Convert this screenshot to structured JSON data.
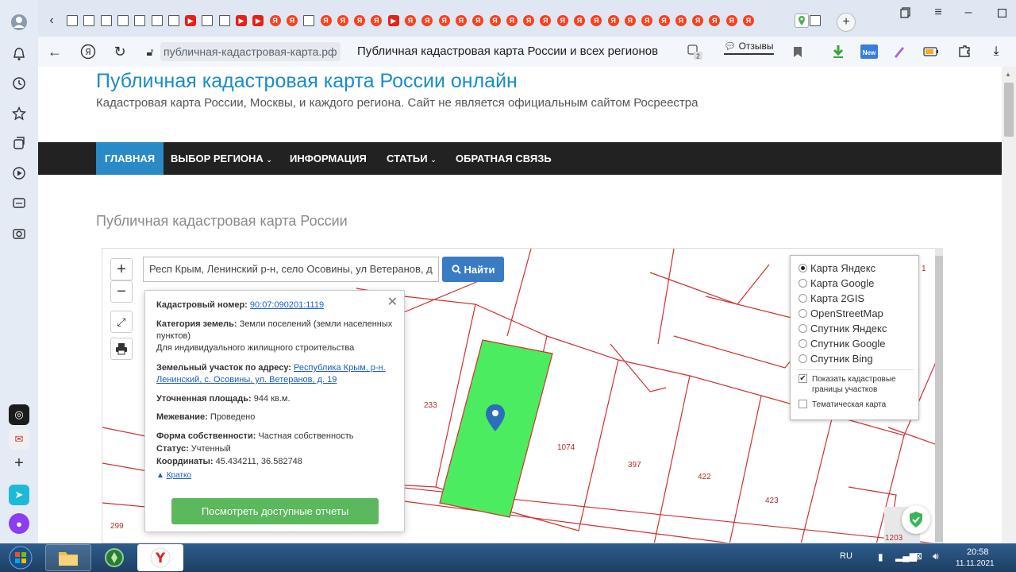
{
  "browser": {
    "url_domain": "публичная-кадастровая-карта.рф",
    "page_title": "Публичная кадастровая карта России и всех регионов",
    "reviews_label": "Отзывы",
    "badge_count": "2",
    "new_badge": "New"
  },
  "site": {
    "title": "Публичная кадастровая карта России онлайн",
    "description": "Кадастровая карта России, Москвы, и каждого региона. Сайт не является официальным сайтом Росреестра",
    "nav": [
      {
        "label": "ГЛАВНАЯ"
      },
      {
        "label": "ВЫБОР РЕГИОНА"
      },
      {
        "label": "ИНФОРМАЦИЯ"
      },
      {
        "label": "СТАТЬИ"
      },
      {
        "label": "ОБРАТНАЯ СВЯЗЬ"
      }
    ],
    "section_title": "Публичная кадастровая карта России"
  },
  "map": {
    "zoom_in": "+",
    "zoom_out": "−",
    "search_value": "Респ Крым, Ленинский р-н, село Осовины, ул Ветеранов, д",
    "find_button": "Найти",
    "popup": {
      "cad_label": "Кадастровый номер:",
      "cad_value": "90:07:090201:1119",
      "category_label": "Категория земель:",
      "category_value": "Земли поселений (земли населенных пунктов)",
      "category_use": "Для индивидуального жилищного строительства",
      "address_label": "Земельный участок по адресу:",
      "address_value": "Республика Крым, р-н. Ленинский, с. Осовины, ул. Ветеранов, д. 19",
      "area_label": "Уточненная площадь:",
      "area_value": "944 кв.м.",
      "survey_label": "Межевание:",
      "survey_value": "Проведено",
      "ownership_label": "Форма собственности:",
      "ownership_value": "Частная собственность",
      "status_label": "Статус:",
      "status_value": "Учтенный",
      "coords_label": "Координаты:",
      "coords_value": "45.434211, 36.582748",
      "collapse_link": "Кратко",
      "reports_button": "Посмотреть доступные отчеты"
    },
    "layers": [
      {
        "label": "Карта Яндекс",
        "selected": true
      },
      {
        "label": "Карта Google",
        "selected": false
      },
      {
        "label": "Карта 2GIS",
        "selected": false
      },
      {
        "label": "OpenStreetMap",
        "selected": false
      },
      {
        "label": "Спутник Яндекс",
        "selected": false
      },
      {
        "label": "Спутник Google",
        "selected": false
      },
      {
        "label": "Спутник Bing",
        "selected": false
      }
    ],
    "show_cadastral": "Показать кадастровые границы участков",
    "thematic": "Тематическая карта",
    "parcel_numbers": [
      "233",
      "1074",
      "397",
      "422",
      "423",
      "299",
      "1203",
      "1"
    ],
    "colors": {
      "parcel_highlight": "#4cec60",
      "parcel_border": "#d03030",
      "marker": "#2a6fb8"
    }
  },
  "taskbar": {
    "lang": "RU",
    "time": "20:58",
    "date": "11.11.2021"
  }
}
